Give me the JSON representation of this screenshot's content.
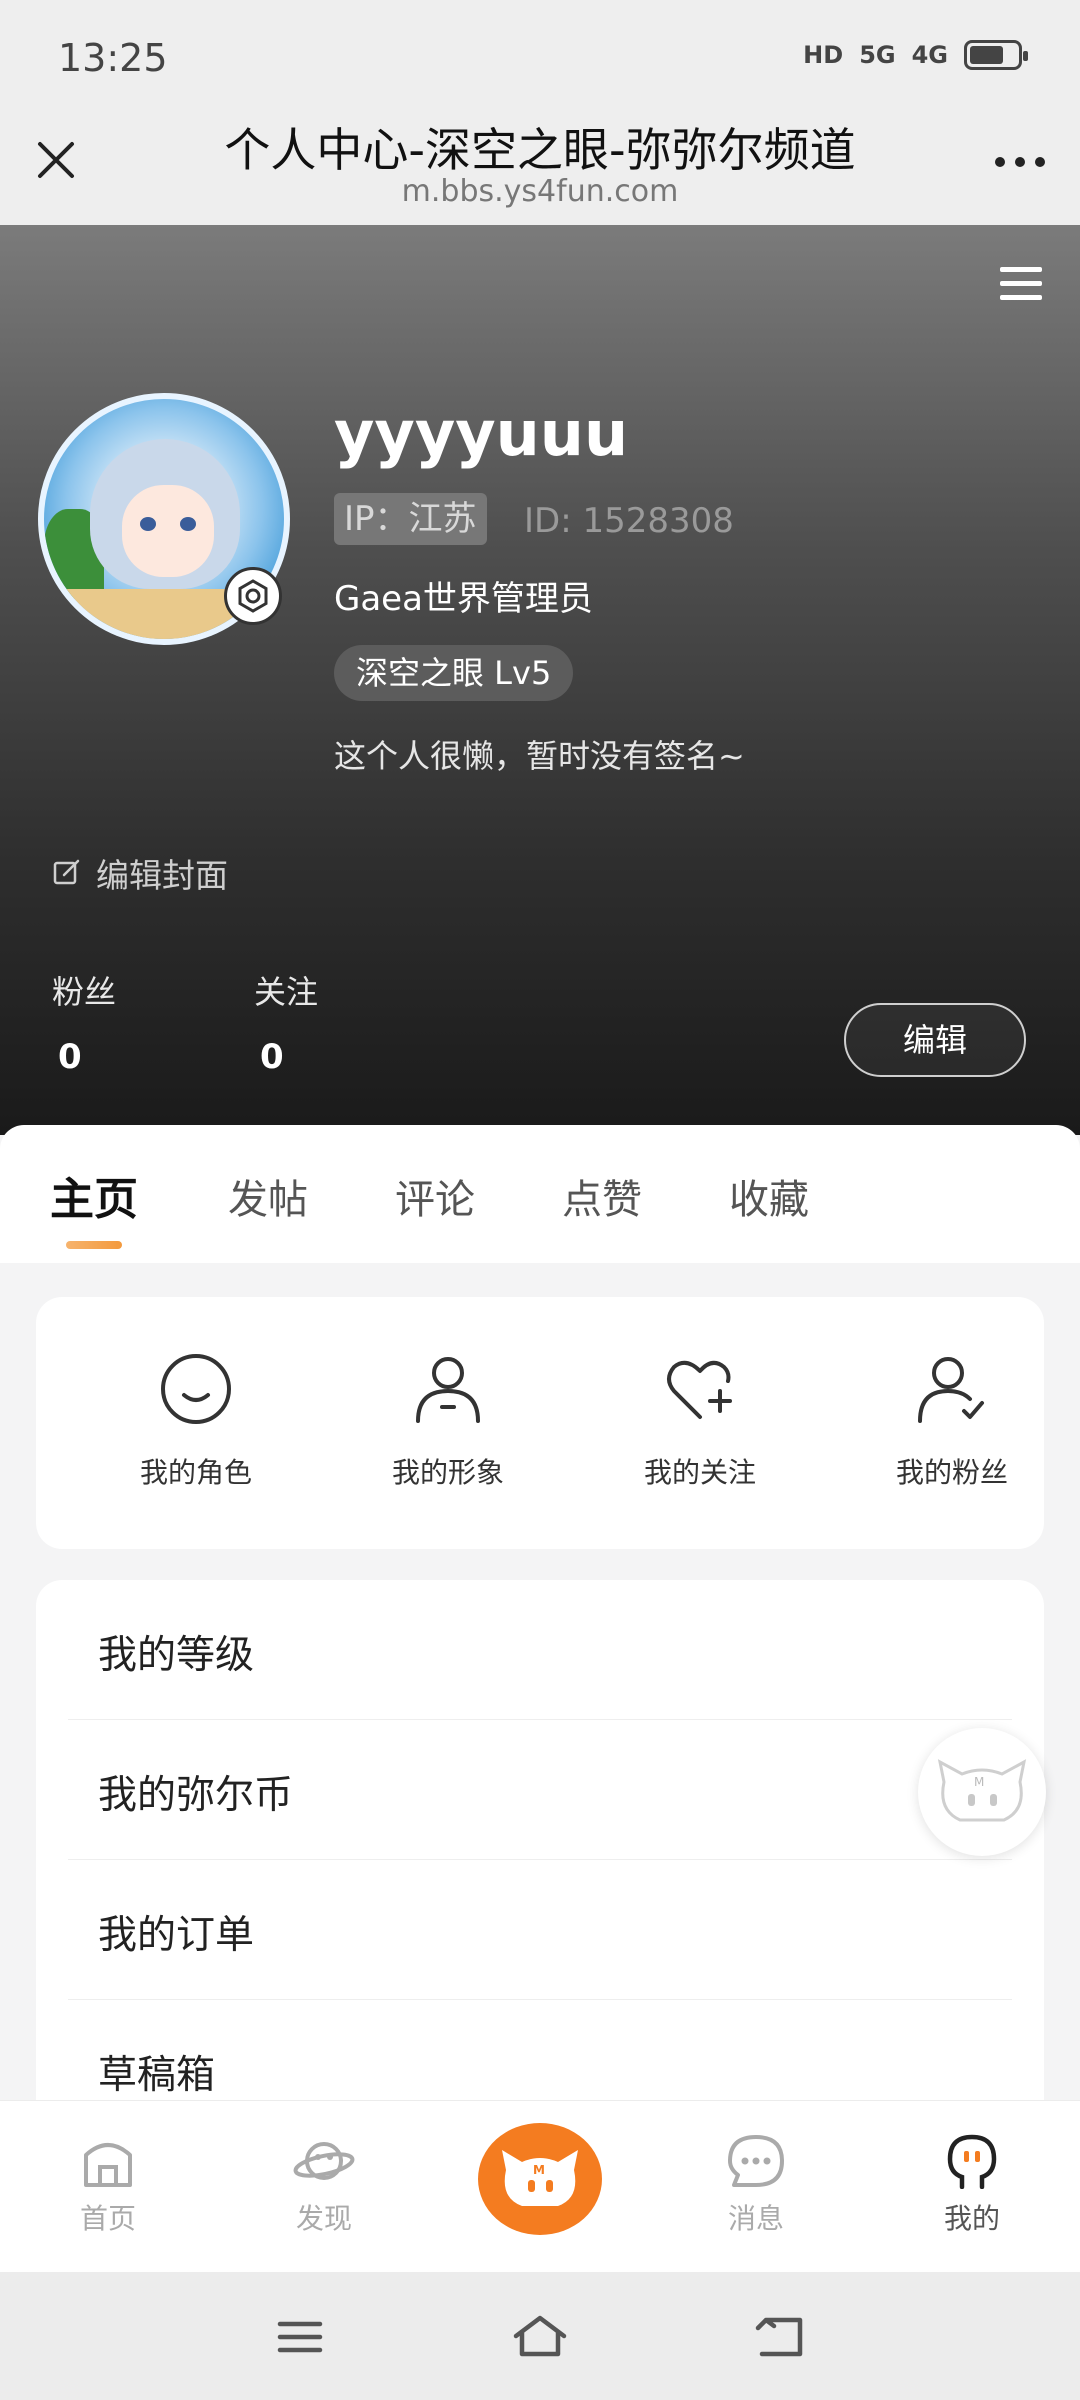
{
  "status_bar": {
    "time": "13:25",
    "hd_label": "HD",
    "net1": "5G",
    "net2": "4G",
    "battery_level": 0.72
  },
  "browser": {
    "title": "个人中心-深空之眼-弥弥尔频道",
    "url": "m.bbs.ys4fun.com",
    "close_icon": "close-icon",
    "more_icon": "more-dots-icon"
  },
  "profile": {
    "username": "yyyyuuu",
    "ip_label": "IP：江苏",
    "id_label": "ID: 1528308",
    "role": "Gaea世界管理员",
    "level": "深空之眼 Lv5",
    "signature": "这个人很懒，暂时没有签名~",
    "edit_cover": "编辑封面",
    "fans_label": "粉丝",
    "fans_count": "0",
    "follow_label": "关注",
    "follow_count": "0",
    "edit_button": "编辑"
  },
  "tabs": [
    {
      "label": "主页",
      "active": true
    },
    {
      "label": "发帖",
      "active": false
    },
    {
      "label": "评论",
      "active": false
    },
    {
      "label": "点赞",
      "active": false
    },
    {
      "label": "收藏",
      "active": false
    }
  ],
  "quick_links": [
    {
      "label": "我的角色",
      "icon": "smile-face-icon"
    },
    {
      "label": "我的形象",
      "icon": "user-icon"
    },
    {
      "label": "我的关注",
      "icon": "heart-plus-icon"
    },
    {
      "label": "我的粉丝",
      "icon": "user-check-icon"
    }
  ],
  "menu_items": [
    {
      "label": "我的等级"
    },
    {
      "label": "我的弥尔币"
    },
    {
      "label": "我的订单"
    },
    {
      "label": "草稿箱"
    }
  ],
  "bottom_nav": [
    {
      "label": "首页",
      "icon": "home-icon",
      "active": false
    },
    {
      "label": "发现",
      "icon": "planet-icon",
      "active": false
    },
    {
      "label": "",
      "icon": "mascot-icon",
      "active": false
    },
    {
      "label": "消息",
      "icon": "chat-icon",
      "active": false
    },
    {
      "label": "我的",
      "icon": "profile-icon",
      "active": true
    }
  ],
  "colors": {
    "accent": "#f47c20",
    "cover_dark": "#1a1a1a"
  }
}
